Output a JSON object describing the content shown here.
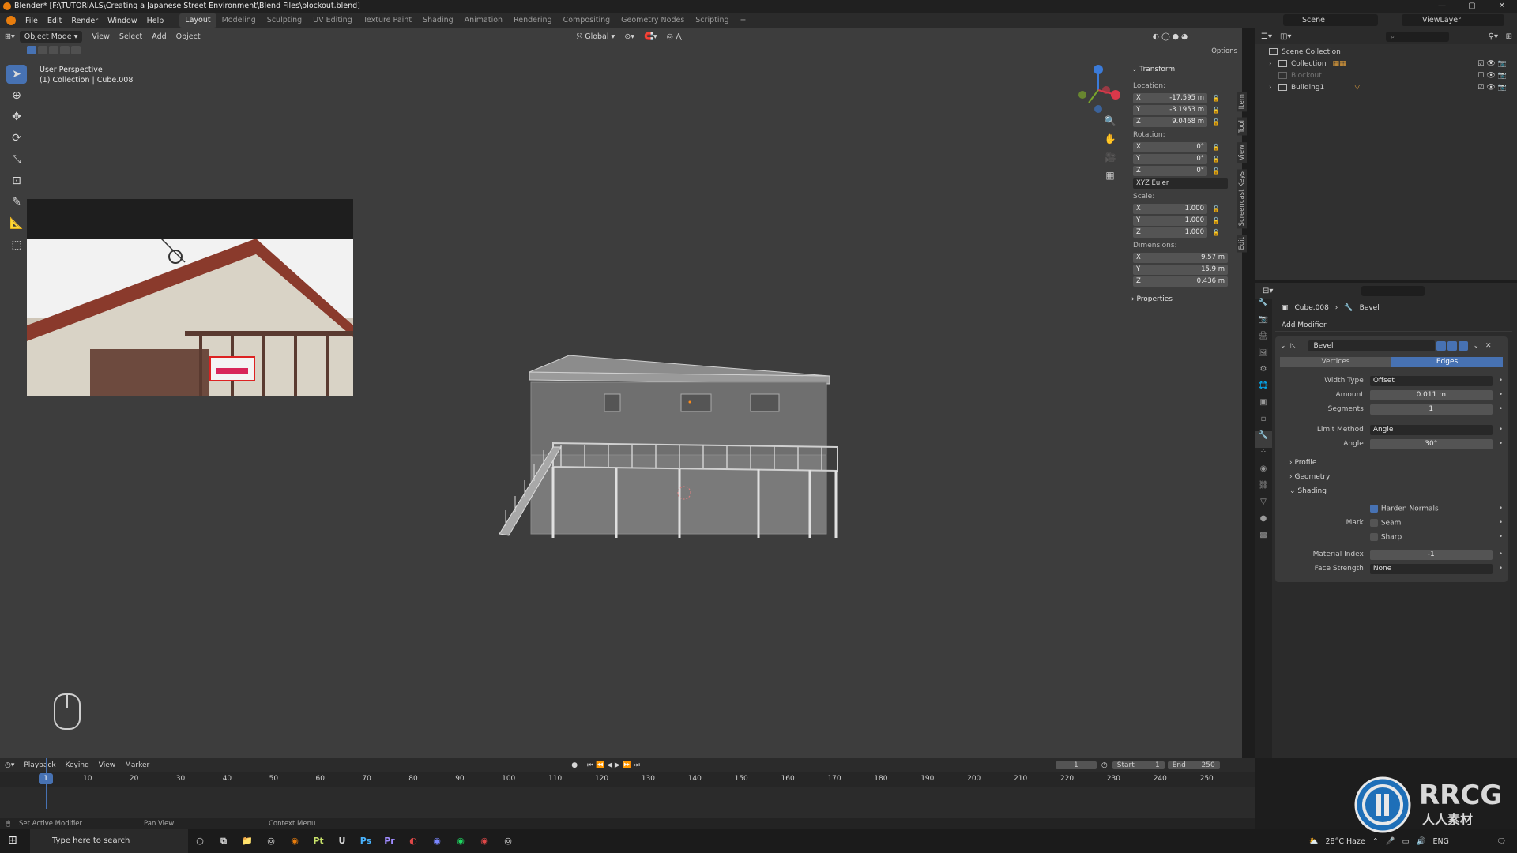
{
  "titlebar": {
    "title": "Blender* [F:\\TUTORIALS\\Creating a Japanese Street Environment\\Blend Files\\blockout.blend]"
  },
  "menu": {
    "items": [
      "File",
      "Edit",
      "Render",
      "Window",
      "Help"
    ],
    "workspaces": [
      "Layout",
      "Modeling",
      "Sculpting",
      "UV Editing",
      "Texture Paint",
      "Shading",
      "Animation",
      "Rendering",
      "Compositing",
      "Geometry Nodes",
      "Scripting"
    ],
    "active_workspace": "Layout",
    "scene": "Scene",
    "view_layer": "ViewLayer"
  },
  "viewport": {
    "mode": "Object Mode",
    "menus": [
      "View",
      "Select",
      "Add",
      "Object"
    ],
    "orientation": "Global",
    "options": "Options",
    "info_line1": "User Perspective",
    "info_line2": "(1) Collection | Cube.008"
  },
  "transform": {
    "header": "Transform",
    "location_label": "Location:",
    "location": [
      {
        "axis": "X",
        "value": "-17.595 m"
      },
      {
        "axis": "Y",
        "value": "-3.1953 m"
      },
      {
        "axis": "Z",
        "value": "9.0468 m"
      }
    ],
    "rotation_label": "Rotation:",
    "rotation": [
      {
        "axis": "X",
        "value": "0°"
      },
      {
        "axis": "Y",
        "value": "0°"
      },
      {
        "axis": "Z",
        "value": "0°"
      }
    ],
    "rotation_mode": "XYZ Euler",
    "scale_label": "Scale:",
    "scale": [
      {
        "axis": "X",
        "value": "1.000"
      },
      {
        "axis": "Y",
        "value": "1.000"
      },
      {
        "axis": "Z",
        "value": "1.000"
      }
    ],
    "dimensions_label": "Dimensions:",
    "dimensions": [
      {
        "axis": "X",
        "value": "9.57 m"
      },
      {
        "axis": "Y",
        "value": "15.9 m"
      },
      {
        "axis": "Z",
        "value": "0.436 m"
      }
    ],
    "properties": "Properties"
  },
  "ntabs": [
    "Item",
    "Tool",
    "View",
    "Screencast Keys",
    "Edit"
  ],
  "outliner": {
    "root": "Scene Collection",
    "items": [
      {
        "name": "Collection"
      },
      {
        "name": "Blockout"
      },
      {
        "name": "Building1"
      }
    ]
  },
  "properties": {
    "object": "Cube.008",
    "modifier_crumb": "Bevel",
    "add_modifier": "Add Modifier",
    "modifier_name": "Bevel",
    "affect_vertices": "Vertices",
    "affect_edges": "Edges",
    "width_type_label": "Width Type",
    "width_type": "Offset",
    "amount_label": "Amount",
    "amount": "0.011 m",
    "segments_label": "Segments",
    "segments": "1",
    "limit_method_label": "Limit Method",
    "limit_method": "Angle",
    "angle_label": "Angle",
    "angle": "30°",
    "profile": "Profile",
    "geometry": "Geometry",
    "shading": "Shading",
    "harden_normals": "Harden Normals",
    "mark_label": "Mark",
    "seam": "Seam",
    "sharp": "Sharp",
    "material_index_label": "Material Index",
    "material_index": "-1",
    "face_strength_label": "Face Strength",
    "face_strength": "None"
  },
  "timeline": {
    "menus": [
      "Playback",
      "Keying",
      "View",
      "Marker"
    ],
    "current_frame": "1",
    "start_label": "Start",
    "start": "1",
    "end_label": "End",
    "end": "250",
    "frame_numbers": [
      "1",
      "10",
      "20",
      "30",
      "40",
      "50",
      "60",
      "70",
      "80",
      "90",
      "100",
      "110",
      "120",
      "130",
      "140",
      "150",
      "160",
      "170",
      "180",
      "190",
      "200",
      "210",
      "220",
      "230",
      "240",
      "250"
    ]
  },
  "statusbar": {
    "left": "Set Active Modifier",
    "middle": "Pan View",
    "right": "Context Menu"
  },
  "taskbar": {
    "search": "Type here to search",
    "apps": [
      "Pt",
      "U",
      "Ps",
      "Pr"
    ],
    "weather": "28°C  Haze",
    "lang": "ENG"
  },
  "watermark": {
    "brand": "RRCG",
    "cn": "人人素材"
  },
  "colors": {
    "accent": "#4772b3",
    "blender_orange": "#e87d0d"
  }
}
